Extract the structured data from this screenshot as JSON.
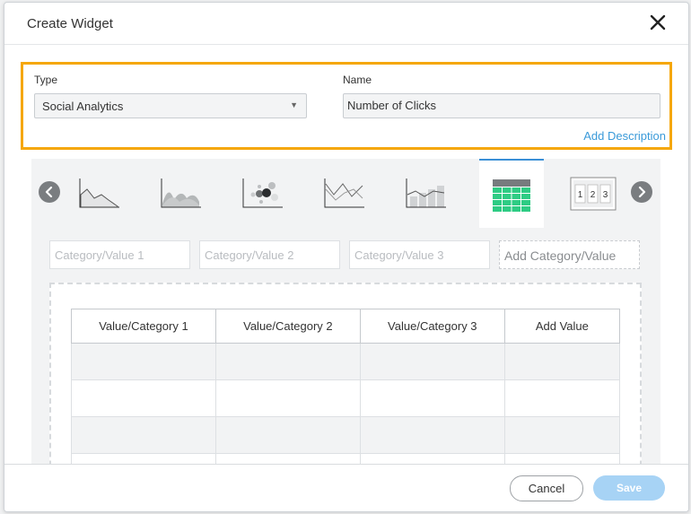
{
  "dialog": {
    "title": "Create Widget"
  },
  "form": {
    "type_label": "Type",
    "type_value": "Social Analytics",
    "name_label": "Name",
    "name_value": "Number of Clicks",
    "add_description": "Add Description"
  },
  "chart_types": [
    {
      "icon": "area-chart-icon",
      "selected": false
    },
    {
      "icon": "multi-area-chart-icon",
      "selected": false
    },
    {
      "icon": "bubble-chart-icon",
      "selected": false
    },
    {
      "icon": "line-chart-icon",
      "selected": false
    },
    {
      "icon": "bar-line-chart-icon",
      "selected": false
    },
    {
      "icon": "table-chart-icon",
      "selected": true
    },
    {
      "icon": "number-chart-icon",
      "selected": false
    }
  ],
  "number_icon_digits": [
    "1",
    "2",
    "3"
  ],
  "categories": {
    "placeholders": [
      "Category/Value 1",
      "Category/Value 2",
      "Category/Value 3"
    ],
    "add_label": "Add Category/Value"
  },
  "table": {
    "headers": [
      "Value/Category 1",
      "Value/Category 2",
      "Value/Category 3",
      "Add Value"
    ]
  },
  "footer": {
    "cancel": "Cancel",
    "save": "Save"
  },
  "colors": {
    "highlight": "#f5a70a",
    "link": "#3a9ad9",
    "selected_tab": "#3a8fd6",
    "table_icon_green": "#2ecc84",
    "save_button": "#a7d3f5"
  }
}
